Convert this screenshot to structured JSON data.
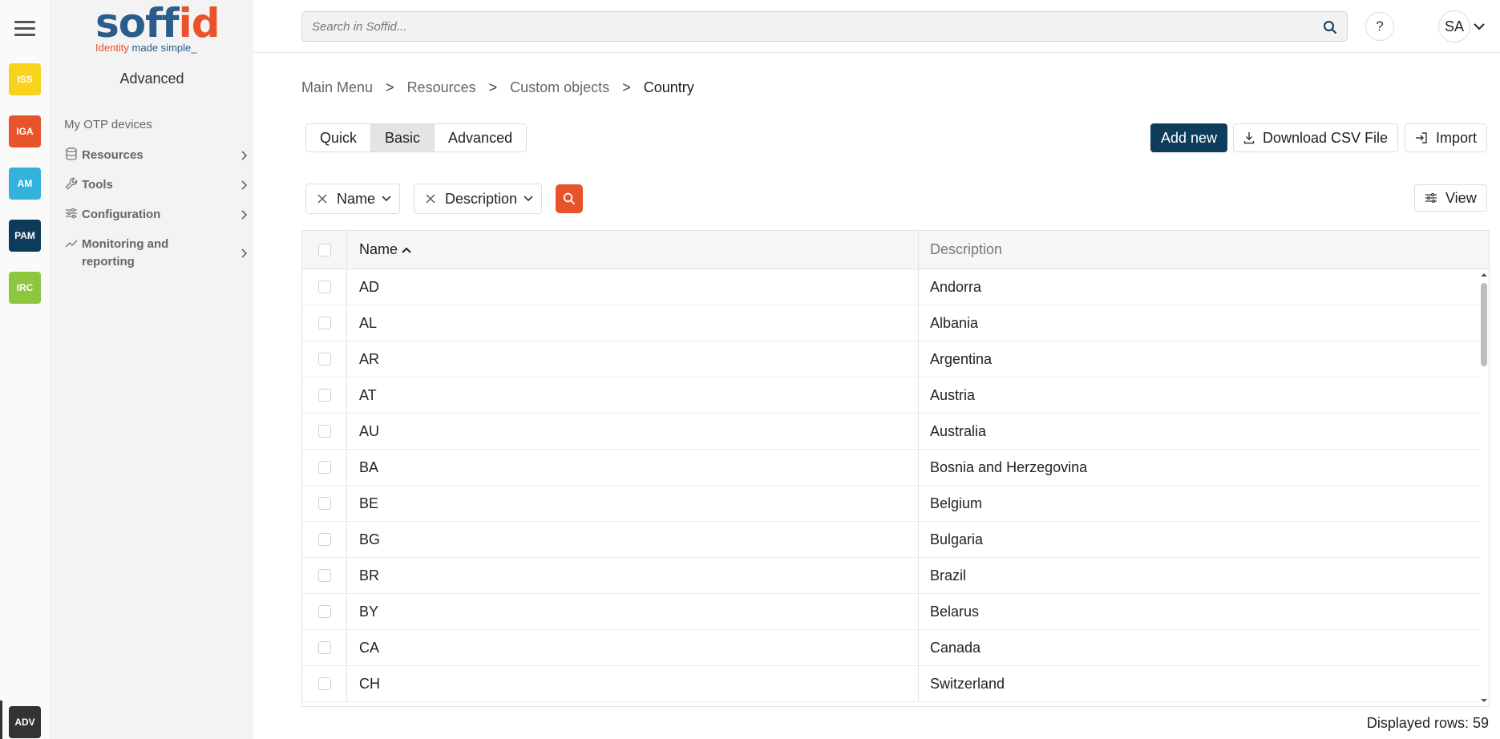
{
  "rail": {
    "apps": [
      {
        "code": "ISS",
        "color": "#f8d21c"
      },
      {
        "code": "IGA",
        "color": "#e8532c"
      },
      {
        "code": "AM",
        "color": "#33b3dc"
      },
      {
        "code": "PAM",
        "color": "#0f3b5a"
      },
      {
        "code": "IRC",
        "color": "#8dc63f"
      }
    ],
    "active": {
      "code": "ADV",
      "color": "#333333"
    }
  },
  "logo": {
    "word_start": "soff",
    "word_accent": "id",
    "tag_start": "Identity",
    "tag_end": "made simple_"
  },
  "sidebar": {
    "title": "Advanced",
    "link": "My OTP devices",
    "items": [
      {
        "label": "Resources",
        "icon": "database-icon"
      },
      {
        "label": "Tools",
        "icon": "wrench-icon"
      },
      {
        "label": "Configuration",
        "icon": "sliders-icon"
      },
      {
        "label": "Monitoring and reporting",
        "icon": "chart-line-icon"
      }
    ]
  },
  "header": {
    "search_placeholder": "Search in Soffid...",
    "help": "?",
    "avatar": "SA"
  },
  "breadcrumb": [
    "Main Menu",
    "Resources",
    "Custom objects",
    "Country"
  ],
  "breadcrumb_sep": ">",
  "mode_tabs": {
    "items": [
      "Quick",
      "Basic",
      "Advanced"
    ],
    "selected": "Basic"
  },
  "actions": {
    "add": "Add new",
    "csv": "Download CSV File",
    "import": "Import",
    "view": "View"
  },
  "filters": [
    "Name",
    "Description"
  ],
  "table": {
    "columns": {
      "name": "Name",
      "description": "Description"
    },
    "sort": "Name ascending",
    "rows": [
      {
        "name": "AD",
        "description": "Andorra"
      },
      {
        "name": "AL",
        "description": "Albania"
      },
      {
        "name": "AR",
        "description": "Argentina"
      },
      {
        "name": "AT",
        "description": "Austria"
      },
      {
        "name": "AU",
        "description": "Australia"
      },
      {
        "name": "BA",
        "description": "Bosnia and Herzegovina"
      },
      {
        "name": "BE",
        "description": "Belgium"
      },
      {
        "name": "BG",
        "description": "Bulgaria"
      },
      {
        "name": "BR",
        "description": "Brazil"
      },
      {
        "name": "BY",
        "description": "Belarus"
      },
      {
        "name": "CA",
        "description": "Canada"
      },
      {
        "name": "CH",
        "description": "Switzerland"
      }
    ]
  },
  "footer": {
    "displayed_rows": "Displayed rows: 59"
  }
}
